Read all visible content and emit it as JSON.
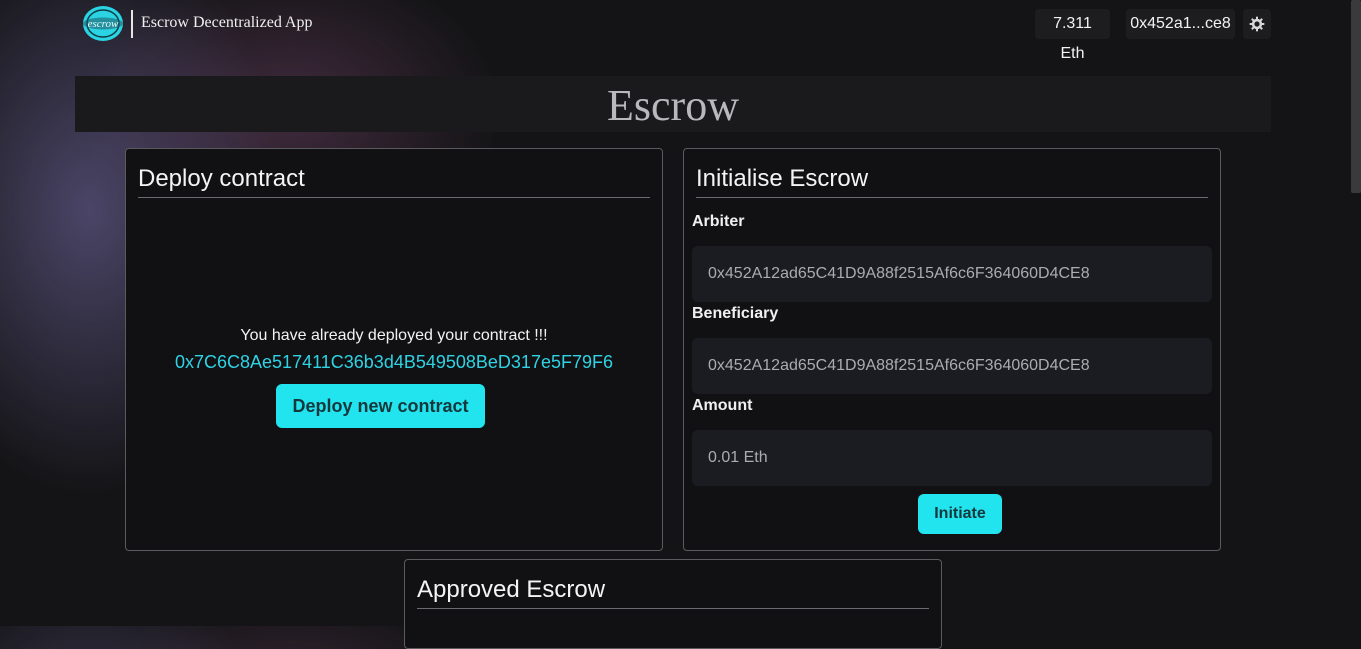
{
  "header": {
    "logo_text": "escrow",
    "app_name": "Escrow Decentralized App",
    "balance": "7.311 Eth",
    "account": "0x452a1...ce8"
  },
  "page": {
    "title": "Escrow"
  },
  "deploy": {
    "title": "Deploy contract",
    "message": "You have already deployed your contract !!!",
    "address": "0x7C6C8Ae517411C36b3d4B549508BeD317e5F79F6",
    "button": "Deploy new contract"
  },
  "init": {
    "title": "Initialise Escrow",
    "arbiter_label": "Arbiter",
    "arbiter_placeholder": "0x452A12ad65C41D9A88f2515Af6c6F364060D4CE8",
    "beneficiary_label": "Beneficiary",
    "beneficiary_placeholder": "0x452A12ad65C41D9A88f2515Af6c6F364060D4CE8",
    "amount_label": "Amount",
    "amount_placeholder": "0.01 Eth",
    "button": "Initiate"
  },
  "approved": {
    "title": "Approved Escrow"
  },
  "colors": {
    "accent": "#22e4ef",
    "address": "#2fd3e4"
  }
}
